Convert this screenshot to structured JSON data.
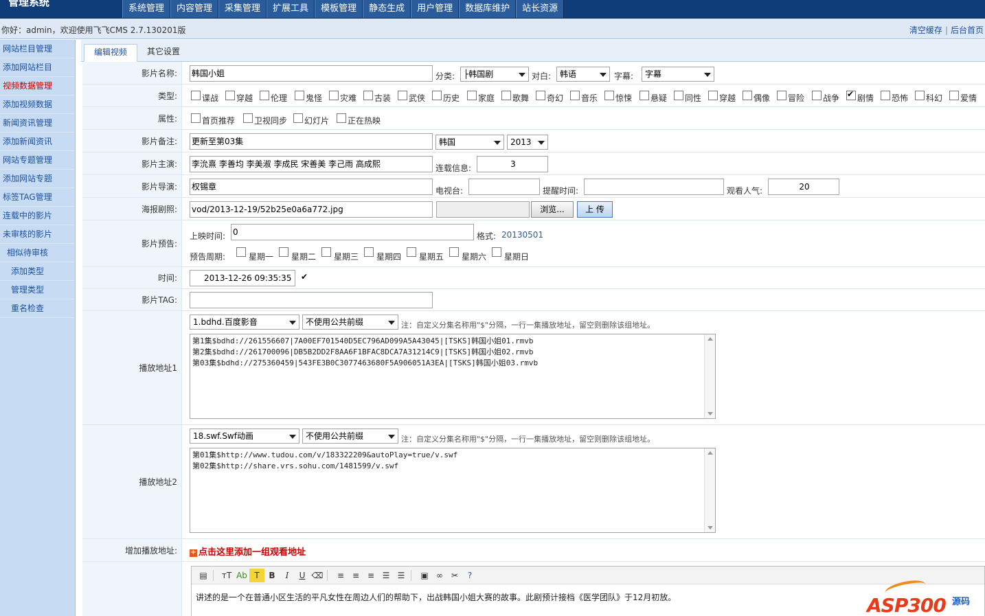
{
  "app": {
    "title": "管理系统"
  },
  "topnav": [
    "系统管理",
    "内容管理",
    "采集管理",
    "扩展工具",
    "模板管理",
    "静态生成",
    "用户管理",
    "数据库维护",
    "站长资源"
  ],
  "infobar": {
    "welcome": "你好：admin，欢迎使用飞飞CMS 2.7.130201版",
    "clear_cache": "清空缓存",
    "home": "后台首页",
    "sep": "|"
  },
  "sidebar": [
    "网站栏目管理",
    "添加网站栏目",
    "视频数据管理",
    "添加视频数据",
    "新闻资讯管理",
    "添加新闻资讯",
    "网站专题管理",
    "添加网站专题",
    "标签TAG管理",
    "连载中的影片",
    "未审核的影片",
    "相似待审核",
    "添加类型",
    "管理类型",
    "重名检查"
  ],
  "tabs": [
    "编辑视频",
    "其它设置"
  ],
  "form": {
    "name_label": "影片名称:",
    "name_value": "韩国小姐",
    "category_label": "分类:",
    "category_value": "├韩国剧",
    "dialogue_label": "对白:",
    "dialogue_value": "韩语",
    "subtitle_label": "字幕:",
    "subtitle_value": "字幕",
    "type_label": "类型:",
    "types": [
      {
        "label": "谍战",
        "checked": false
      },
      {
        "label": "穿越",
        "checked": false
      },
      {
        "label": "伦理",
        "checked": false
      },
      {
        "label": "鬼怪",
        "checked": false
      },
      {
        "label": "灾难",
        "checked": false
      },
      {
        "label": "古装",
        "checked": false
      },
      {
        "label": "武侠",
        "checked": false
      },
      {
        "label": "历史",
        "checked": false
      },
      {
        "label": "家庭",
        "checked": false
      },
      {
        "label": "歌舞",
        "checked": false
      },
      {
        "label": "奇幻",
        "checked": false
      },
      {
        "label": "音乐",
        "checked": false
      },
      {
        "label": "惊悚",
        "checked": false
      },
      {
        "label": "悬疑",
        "checked": false
      },
      {
        "label": "同性",
        "checked": false
      },
      {
        "label": "穿越",
        "checked": false
      },
      {
        "label": "偶像",
        "checked": false
      },
      {
        "label": "冒险",
        "checked": false
      },
      {
        "label": "战争",
        "checked": false
      },
      {
        "label": "剧情",
        "checked": true
      },
      {
        "label": "恐怖",
        "checked": false
      },
      {
        "label": "科幻",
        "checked": false
      },
      {
        "label": "爱情",
        "checked": false
      }
    ],
    "attr_label": "属性:",
    "attrs": [
      "首页推荐",
      "卫视同步",
      "幻灯片",
      "正在热映"
    ],
    "remark_label": "影片备注:",
    "remark_value": "更新至第03集",
    "area_value": "韩国",
    "year_value": "2013",
    "actor_label": "影片主演:",
    "actor_value": "李沇熹 李善均 李美淑 李成民 宋善美 李己雨 高成熙",
    "serial_label": "连载信息:",
    "serial_value": "3",
    "director_label": "影片导演:",
    "director_value": "权锡章",
    "tv_label": "电视台:",
    "remind_label": "提醒时间:",
    "views_label": "观看人气:",
    "views_value": "20",
    "poster_label": "海报剧照:",
    "poster_value": "vod/2013-12-19/52b25e0a6a772.jpg",
    "browse_label": "浏览...",
    "upload_label": "上 传",
    "preview_label": "影片预告:",
    "showtime_label": "上映时间:",
    "showtime_value": "0",
    "format_label": "格式:",
    "format_value": "20130501",
    "weekly_label": "预告周期:",
    "weekdays": [
      "星期一",
      "星期二",
      "星期三",
      "星期四",
      "星期五",
      "星期六",
      "星期日"
    ],
    "time_label": "时间:",
    "time_value": "2013-12-26 09:35:35",
    "time_checked": true,
    "tag_label": "影片TAG:",
    "play1_label": "播放地址1",
    "play1_source": "1.bdhd.百度影音",
    "play1_prefix": "不使用公共前缀",
    "play_note": "注：自定义分集名称用\"$\"分隔，一行一集播放地址，留空则删除该组地址。",
    "play1_content": "第1集$bdhd://261556607|7A00EF701540D5EC796AD099A5A43045|[TSKS]韩国小姐01.rmvb\n第2集$bdhd://261700096|DB5B2DD2F8AA6F1BFAC8DCA7A31214C9|[TSKS]韩国小姐02.rmvb\n第03集$bdhd://275360459|543FE3B0C3077463680F5A906051A3EA|[TSKS]韩国小姐03.rmvb",
    "play2_label": "播放地址2",
    "play2_source": "18.swf.Swf动画",
    "play2_prefix": "不使用公共前缀",
    "play2_content": "第01集$http://www.tudou.com/v/183322209&autoPlay=true/v.swf\n第02集$http://share.vrs.sohu.com/1481599/v.swf",
    "add_label": "增加播放地址:",
    "add_link": "点击这里添加一组观看地址",
    "intro": "讲述的是一个在普通小区生活的平凡女性在周边人们的帮助下，出战韩国小姐大赛的故事。此剧预计接档《医学团队》于12月初放。"
  },
  "watermark": {
    "brand": "ASP300",
    "suffix": "源码"
  }
}
